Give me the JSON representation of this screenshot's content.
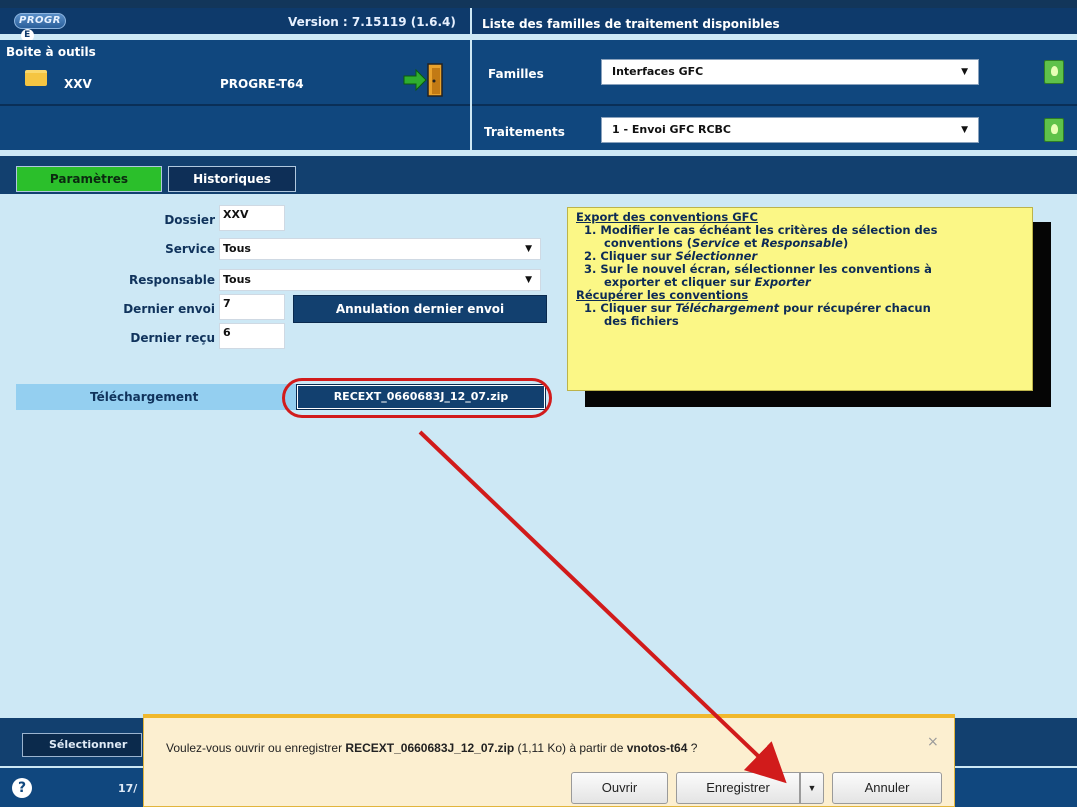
{
  "header": {
    "logo_text": "PROGR",
    "logo_letter": "E",
    "version": "Version : 7.15119 (1.6.4)",
    "right_title": "Liste des familles de traitement disponibles"
  },
  "toolbox": {
    "title": "Boite à outils",
    "folder_label": "XXV",
    "server_label": "PROGRE-T64"
  },
  "selectors": {
    "familles_label": "Familles",
    "familles_value": "Interfaces GFC",
    "traitements_label": "Traitements",
    "traitements_value": "1 - Envoi GFC RCBC"
  },
  "tabs": [
    {
      "label": "Paramètres"
    },
    {
      "label": "Historiques"
    }
  ],
  "form": {
    "dossier_label": "Dossier",
    "dossier_value": "XXV",
    "service_label": "Service",
    "service_value": "Tous",
    "responsable_label": "Responsable",
    "responsable_value": "Tous",
    "dernier_envoi_label": "Dernier envoi",
    "dernier_envoi_value": "7",
    "dernier_recu_label": "Dernier reçu",
    "dernier_recu_value": "6",
    "annulation_button": "Annulation dernier envoi",
    "telechargement_label": "Téléchargement",
    "zip_button": "RECEXT_0660683J_12_07.zip"
  },
  "help": {
    "title1": "Export des conventions GFC",
    "s1_1a": "Modifier le cas échéant les critères de sélection des",
    "s1_1b_pre": "conventions (",
    "s1_1b_em1": "Service",
    "s1_1b_mid": " et ",
    "s1_1b_em2": "Responsable",
    "s1_1b_post": ")",
    "s1_2_pre": "Cliquer sur ",
    "s1_2_em": "Sélectionner",
    "s1_3a": "Sur le nouvel écran, sélectionner les conventions à",
    "s1_3b_pre": "exporter et cliquer sur ",
    "s1_3b_em": "Exporter",
    "title2": "Récupérer les conventions",
    "s2_1a_pre": "Cliquer sur ",
    "s2_1a_em": "Téléchargement",
    "s2_1a_post": " pour récupérer chacun",
    "s2_1b": "des fichiers"
  },
  "bottom": {
    "select_button": "Sélectionner",
    "help_glyph": "?",
    "date_partial": "17/"
  },
  "notification": {
    "msg_pre": "Voulez-vous ouvrir ou enregistrer ",
    "file": "RECEXT_0660683J_12_07.zip",
    "size": " (1,11 Ko) à partir de ",
    "host": "vnotos-t64",
    "msg_post": " ?",
    "close_glyph": "×",
    "open_button": "Ouvrir",
    "save_button": "Enregistrer",
    "dropdown_glyph": "▼",
    "cancel_button": "Annuler"
  },
  "colors": {
    "accent_green": "#2bbf2b",
    "header_blue": "#10477e",
    "panel_bg": "#cde8f5",
    "note_yellow": "#fbf786",
    "annotation_red": "#d11b1b"
  }
}
